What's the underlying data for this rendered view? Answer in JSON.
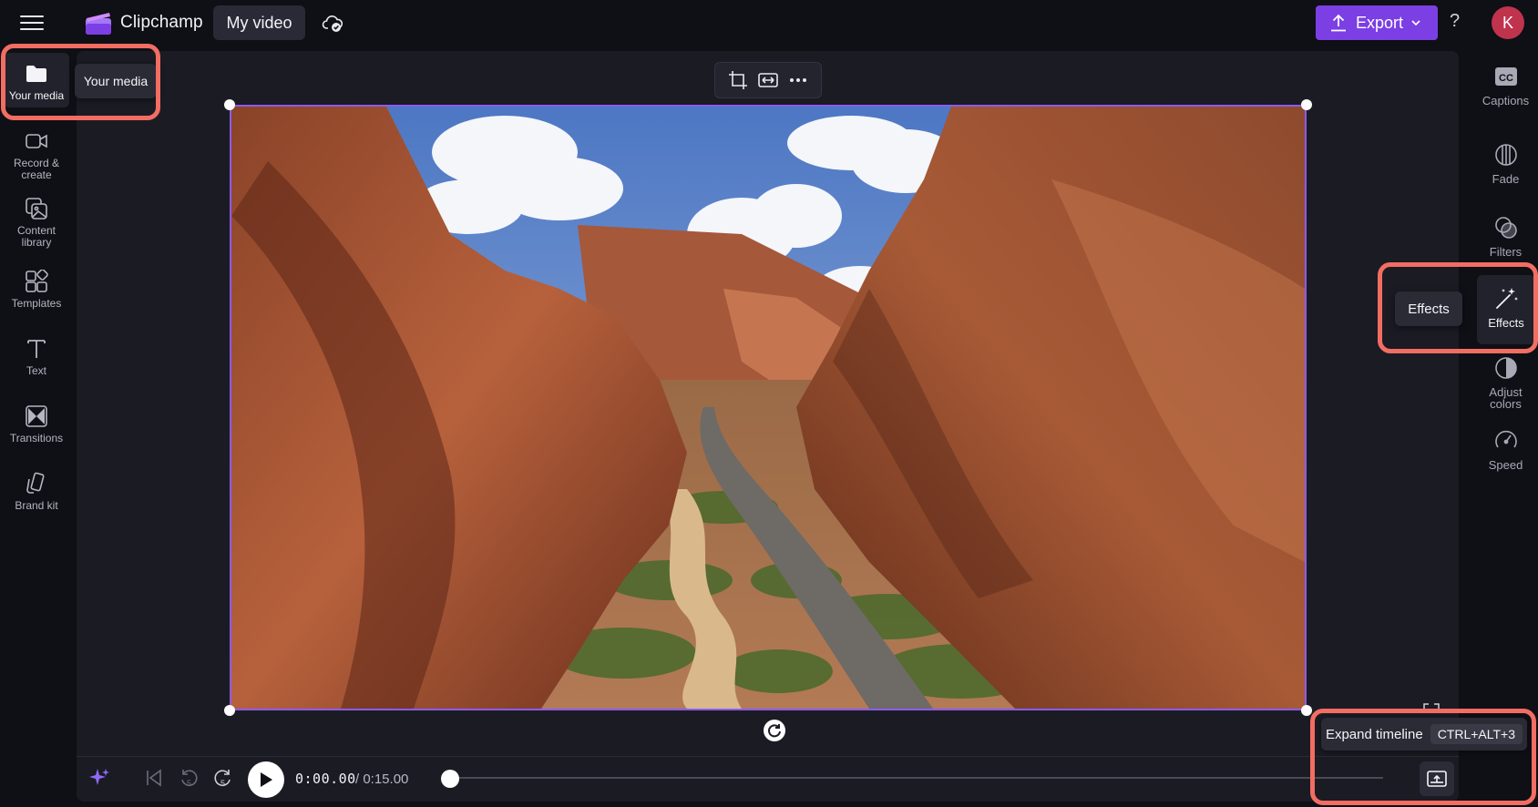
{
  "app": {
    "name": "Clipchamp",
    "project_title": "My video"
  },
  "header": {
    "export_label": "Export",
    "help_label": "?",
    "avatar_initial": "K"
  },
  "left_sidebar": {
    "items": [
      {
        "label_line1": "Your media",
        "label_line2": "",
        "icon": "folder-icon",
        "active": true
      },
      {
        "label_line1": "Record &",
        "label_line2": "create",
        "icon": "video-camera-icon"
      },
      {
        "label_line1": "Content",
        "label_line2": "library",
        "icon": "content-library-icon"
      },
      {
        "label_line1": "Templates",
        "label_line2": "",
        "icon": "templates-icon"
      },
      {
        "label_line1": "Text",
        "label_line2": "",
        "icon": "text-icon"
      },
      {
        "label_line1": "Transitions",
        "label_line2": "",
        "icon": "transitions-icon"
      },
      {
        "label_line1": "Brand kit",
        "label_line2": "",
        "icon": "brand-kit-icon"
      }
    ]
  },
  "right_sidebar": {
    "items": [
      {
        "label_line1": "Captions",
        "label_line2": "",
        "icon": "captions-icon"
      },
      {
        "label_line1": "Fade",
        "label_line2": "",
        "icon": "fade-icon"
      },
      {
        "label_line1": "Filters",
        "label_line2": "",
        "icon": "filters-icon"
      },
      {
        "label_line1": "Effects",
        "label_line2": "",
        "icon": "magic-wand-icon",
        "active": true
      },
      {
        "label_line1": "Adjust",
        "label_line2": "colors",
        "icon": "adjust-colors-icon"
      },
      {
        "label_line1": "Speed",
        "label_line2": "",
        "icon": "speed-icon"
      }
    ]
  },
  "tooltips": {
    "your_media": "Your media",
    "effects": "Effects",
    "expand_timeline": "Expand timeline",
    "expand_timeline_shortcut": "CTRL+ALT+3"
  },
  "playback": {
    "current_time": "0:00.00",
    "total_time": "/ 0:15.00",
    "progress": 0.0,
    "skip_back_seconds": "5",
    "skip_forward_seconds": "5"
  },
  "preview": {
    "description_icon": "canyon-video-frame"
  },
  "colors": {
    "accent": "#7b3fe4",
    "selection": "#8a5cf0",
    "highlight": "#f26d62",
    "avatar": "#c0334d"
  }
}
